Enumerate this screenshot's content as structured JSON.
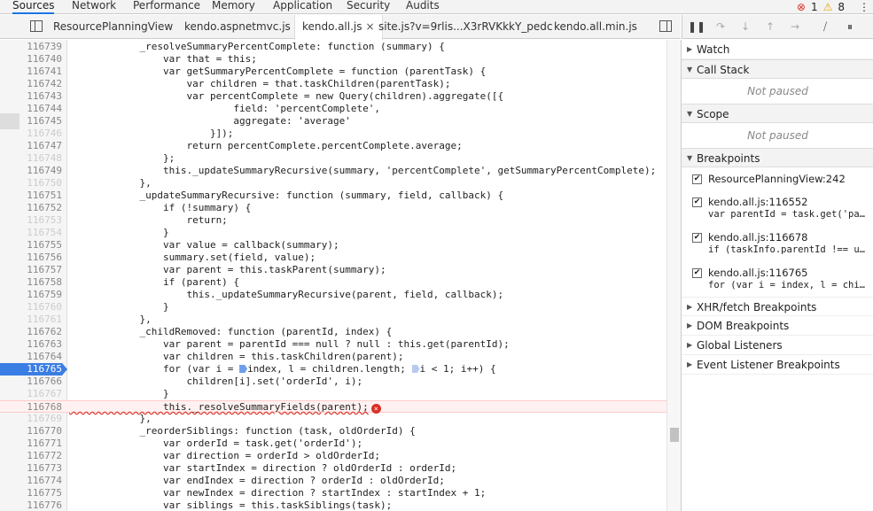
{
  "top_tabs": [
    "Sources",
    "Network",
    "Performance",
    "Memory",
    "Application",
    "Security",
    "Audits"
  ],
  "status": {
    "errors": "1",
    "warnings": "8"
  },
  "file_tabs": [
    {
      "label": "ResourcePlanningView",
      "active": false
    },
    {
      "label": "kendo.aspnetmvc.js",
      "active": false
    },
    {
      "label": "kendo.all.js",
      "active": true,
      "close": "×"
    },
    {
      "label": "site.js?v=9rlis...X3rRVKkkY_pedc",
      "active": false
    },
    {
      "label": "kendo.all.min.js",
      "active": false
    }
  ],
  "code_lines": [
    {
      "n": "116739",
      "t": "            _resolveSummaryPercentComplete: function (summary) {"
    },
    {
      "n": "116740",
      "t": "                var that = this;"
    },
    {
      "n": "116741",
      "t": "                var getSummaryPercentComplete = function (parentTask) {"
    },
    {
      "n": "116742",
      "t": "                    var children = that.taskChildren(parentTask);"
    },
    {
      "n": "116743",
      "t": "                    var percentComplete = new Query(children).aggregate([{"
    },
    {
      "n": "116744",
      "t": "                            field: 'percentComplete',"
    },
    {
      "n": "116745",
      "t": "                            aggregate: 'average'"
    },
    {
      "n": "116746",
      "t": "                        }]);",
      "dim": true
    },
    {
      "n": "116747",
      "t": "                    return percentComplete.percentComplete.average;"
    },
    {
      "n": "116748",
      "t": "                };",
      "dim": true
    },
    {
      "n": "116749",
      "t": "                this._updateSummaryRecursive(summary, 'percentComplete', getSummaryPercentComplete);"
    },
    {
      "n": "116750",
      "t": "            },",
      "dim": true
    },
    {
      "n": "116751",
      "t": "            _updateSummaryRecursive: function (summary, field, callback) {"
    },
    {
      "n": "116752",
      "t": "                if (!summary) {"
    },
    {
      "n": "116753",
      "t": "                    return;",
      "dim": true
    },
    {
      "n": "116754",
      "t": "                }",
      "dim": true
    },
    {
      "n": "116755",
      "t": "                var value = callback(summary);"
    },
    {
      "n": "116756",
      "t": "                summary.set(field, value);"
    },
    {
      "n": "116757",
      "t": "                var parent = this.taskParent(summary);"
    },
    {
      "n": "116758",
      "t": "                if (parent) {"
    },
    {
      "n": "116759",
      "t": "                    this._updateSummaryRecursive(parent, field, callback);"
    },
    {
      "n": "116760",
      "t": "                }",
      "dim": true
    },
    {
      "n": "116761",
      "t": "            },",
      "dim": true
    },
    {
      "n": "116762",
      "t": "            _childRemoved: function (parentId, index) {"
    },
    {
      "n": "116763",
      "t": "                var parent = parentId === null ? null : this.get(parentId);"
    },
    {
      "n": "116764",
      "t": "                var children = this.taskChildren(parent);"
    },
    {
      "n": "116765",
      "t": "",
      "bp": true
    },
    {
      "n": "116766",
      "t": "                    children[i].set('orderId', i);"
    },
    {
      "n": "116767",
      "t": "                }",
      "dim": true
    },
    {
      "n": "116768",
      "t": "",
      "err": true
    },
    {
      "n": "116769",
      "t": "            },",
      "dim": true
    },
    {
      "n": "116770",
      "t": "            _reorderSiblings: function (task, oldOrderId) {"
    },
    {
      "n": "116771",
      "t": "                var orderId = task.get('orderId');"
    },
    {
      "n": "116772",
      "t": "                var direction = orderId > oldOrderId;"
    },
    {
      "n": "116773",
      "t": "                var startIndex = direction ? oldOrderId : orderId;"
    },
    {
      "n": "116774",
      "t": "                var endIndex = direction ? orderId : oldOrderId;"
    },
    {
      "n": "116775",
      "t": "                var newIndex = direction ? startIndex : startIndex + 1;"
    },
    {
      "n": "116776",
      "t": "                var siblings = this.taskSiblings(task);"
    }
  ],
  "bp_line": {
    "a": "                for (var i = ",
    "b": "index, l = children.length; ",
    "c": "i < 1; i++) {"
  },
  "err_line": {
    "text": "                this._resolveSummaryFields(parent);",
    "icon": "×"
  },
  "sidebar": {
    "watch": "Watch",
    "call_stack": "Call Stack",
    "not_paused_1": "Not paused",
    "scope": "Scope",
    "not_paused_2": "Not paused",
    "breakpoints": "Breakpoints",
    "bp_items": [
      {
        "name": "ResourcePlanningView:242",
        "code": ""
      },
      {
        "name": "kendo.all.js:116552",
        "code": "var parentId = task.get('pa…"
      },
      {
        "name": "kendo.all.js:116678",
        "code": "if (taskInfo.parentId !== u…"
      },
      {
        "name": "kendo.all.js:116765",
        "code": "for (var i = index, l = chi…"
      }
    ],
    "xhr": "XHR/fetch Breakpoints",
    "dom": "DOM Breakpoints",
    "global": "Global Listeners",
    "event": "Event Listener Breakpoints"
  }
}
